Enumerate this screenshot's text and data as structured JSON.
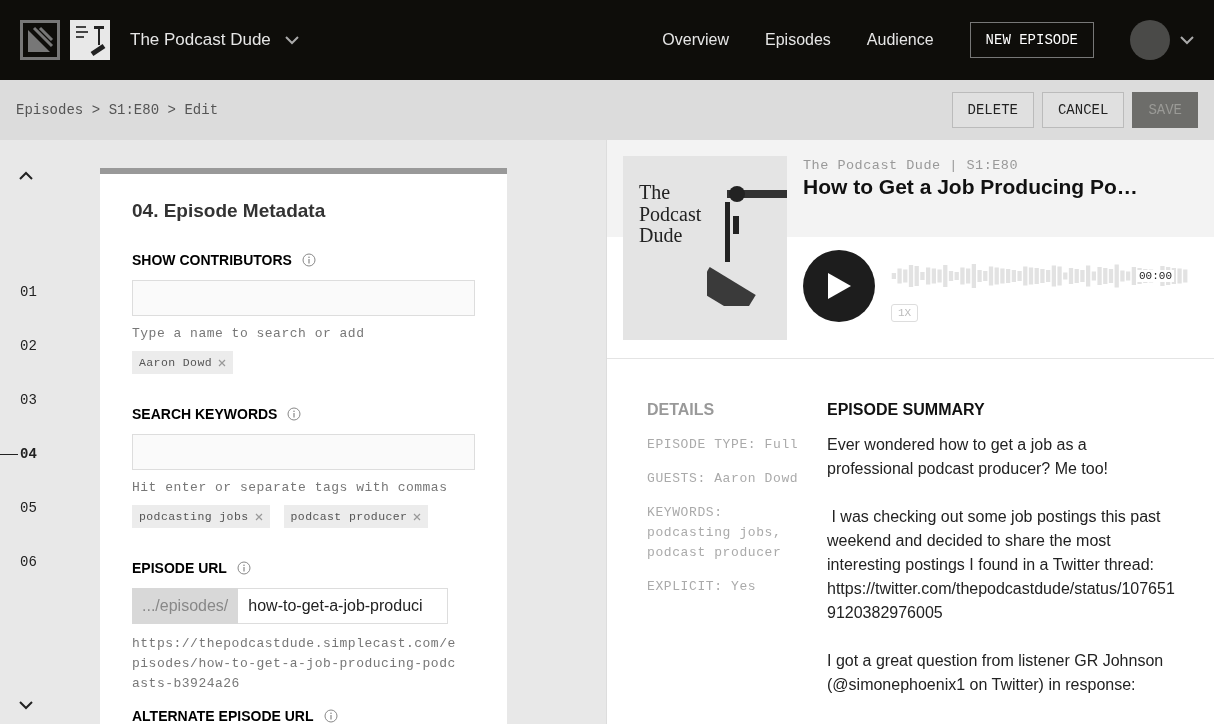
{
  "topbar": {
    "podcast_name": "The Podcast Dude",
    "nav": [
      "Overview",
      "Episodes",
      "Audience"
    ],
    "new_button": "NEW EPISODE"
  },
  "breadcrumb": [
    "Episodes",
    ">",
    "S1:E80",
    ">",
    "Edit"
  ],
  "actions": [
    {
      "label": "DELETE",
      "disabled": false
    },
    {
      "label": "CANCEL",
      "disabled": false
    },
    {
      "label": "SAVE",
      "disabled": true
    }
  ],
  "rail": {
    "items": [
      {
        "label": "01",
        "selected": false
      },
      {
        "label": "02",
        "selected": false
      },
      {
        "label": "03",
        "selected": false
      },
      {
        "label": "04",
        "selected": true
      },
      {
        "label": "05",
        "selected": false
      },
      {
        "label": "06",
        "selected": false
      }
    ]
  },
  "form": {
    "title": "04. Episode Metadata",
    "contributors": {
      "label": "SHOW CONTRIBUTORS",
      "hint": "Type a name to search or add",
      "tags": [
        "Aaron Dowd"
      ]
    },
    "keywords": {
      "label": "SEARCH KEYWORDS",
      "hint": "Hit enter or separate tags with commas",
      "tags": [
        "podcasting jobs",
        "podcast producer"
      ]
    },
    "url": {
      "label": "EPISODE URL",
      "prefix": ".../episodes/",
      "value": "how-to-get-a-job-produci",
      "full": "https://thepodcastdude.simplecast.com/episodes/how-to-get-a-job-producing-podcasts-b3924a26"
    },
    "next_label": "ALTERNATE EPISODE URL"
  },
  "preview": {
    "cover_text": "The Podcast Dude",
    "subtitle": "The Podcast Dude | S1:E80",
    "title": "How to Get a Job Producing Po…",
    "time": "00:00",
    "speed": "1X",
    "details_heading": "DETAILS",
    "details": [
      "EPISODE TYPE: Full",
      "GUESTS: Aaron Dowd",
      "KEYWORDS: podcasting jobs, podcast producer",
      "EXPLICIT: Yes"
    ],
    "summary_heading": "EPISODE SUMMARY",
    "summary": [
      "Ever wondered how to get a job as a professional podcast producer? Me too!",
      " I was checking out some job postings this past weekend and decided to share the most interesting postings I found in a Twitter thread: https://twitter.com/thepodcastdude/status/1076519120382976005",
      "I got a great question from listener GR Johnson (@simonephoenix1 on Twitter) in response:"
    ]
  }
}
